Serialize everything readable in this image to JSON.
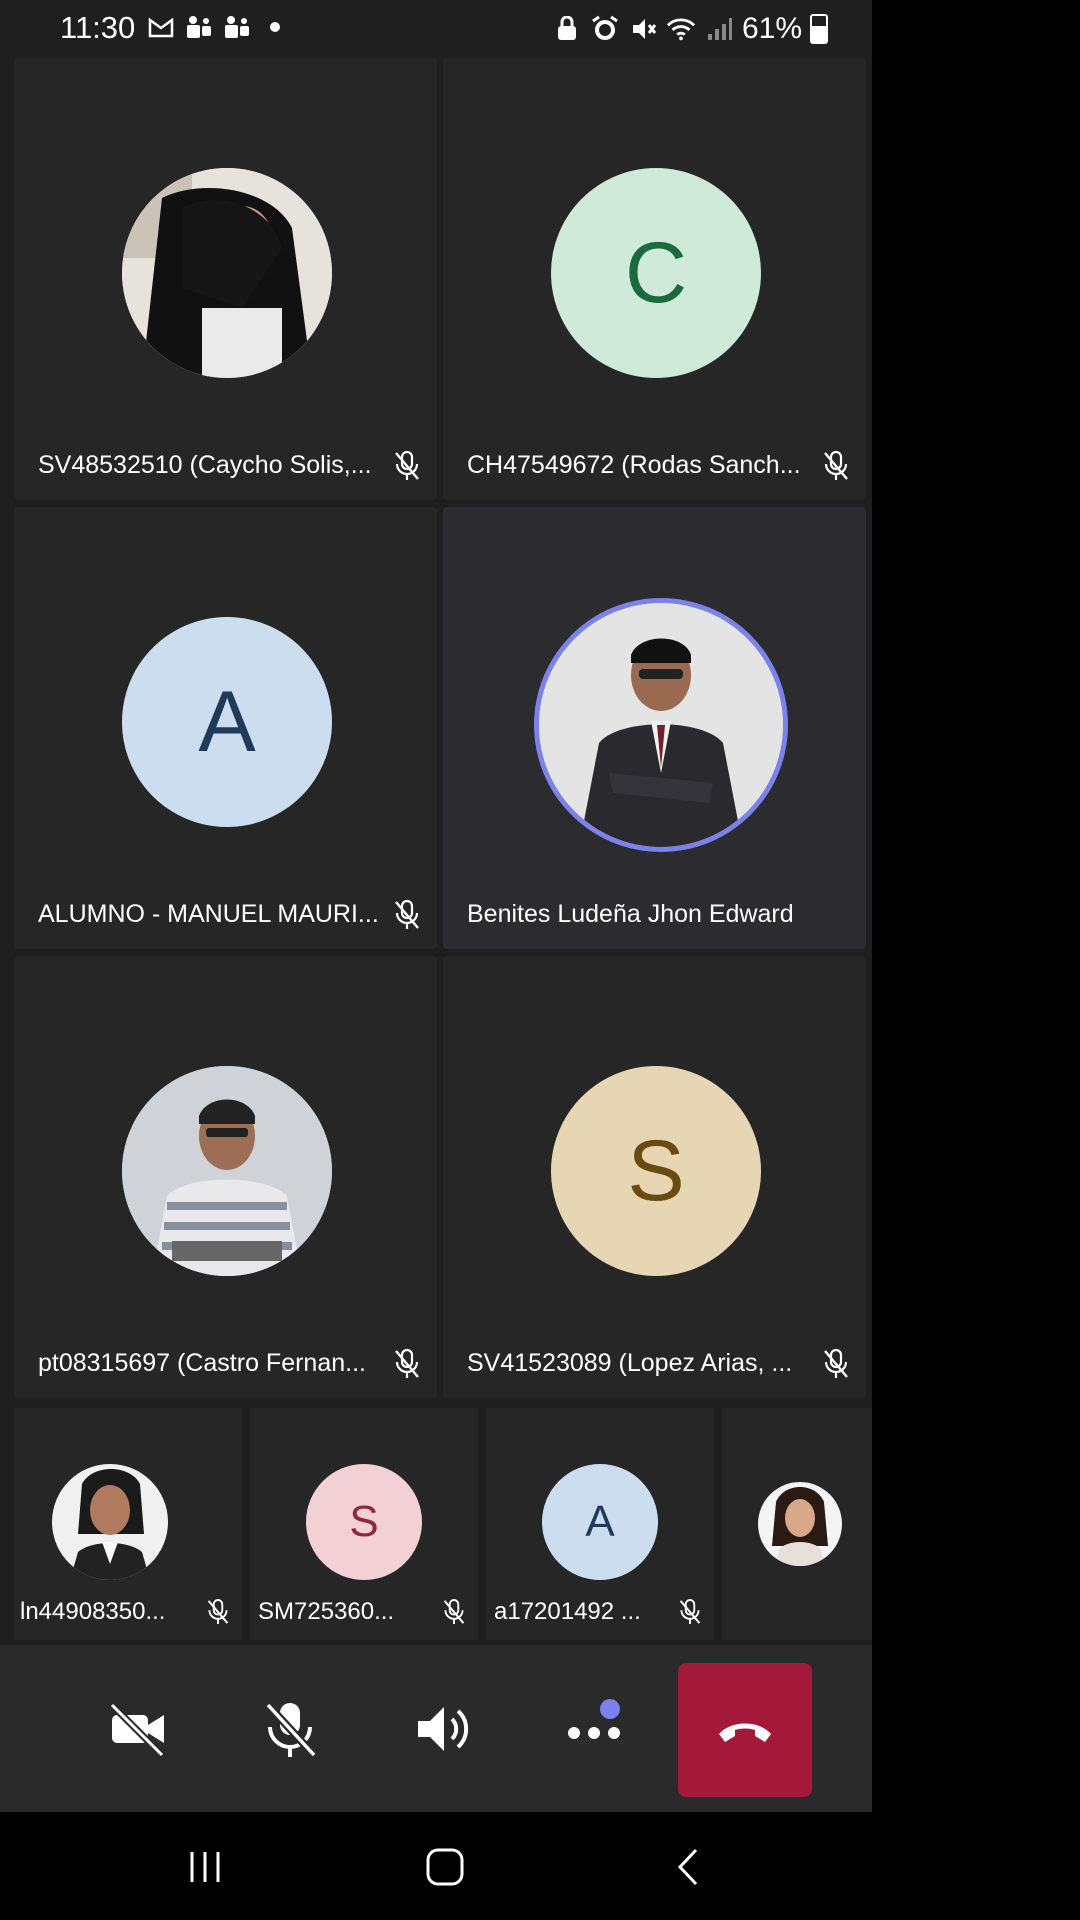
{
  "status": {
    "time": "11:30",
    "battery": "61%"
  },
  "tiles": [
    {
      "name": "SV48532510 (Caycho Solis,...",
      "avatar": "photo-woman-hair",
      "muted": true
    },
    {
      "name": "CH47549672 (Rodas Sanch...",
      "avatar_letter": "C",
      "muted": true
    },
    {
      "name": "ALUMNO - MANUEL MAURI...",
      "avatar_letter": "A",
      "muted": true
    },
    {
      "name": "Benites Ludeña Jhon Edward",
      "avatar": "photo-man-suit",
      "muted": false,
      "speaking": true
    },
    {
      "name": "pt08315697 (Castro Fernan...",
      "avatar": "photo-man-sweater",
      "muted": true
    },
    {
      "name": "SV41523089 (Lopez Arias, ...",
      "avatar_letter": "S",
      "muted": true
    }
  ],
  "small_tiles": [
    {
      "name": "ln44908350...",
      "avatar": "photo-woman",
      "muted": true
    },
    {
      "name": "SM725360...",
      "avatar_letter": "S",
      "muted": true
    },
    {
      "name": "a17201492 ...",
      "avatar_letter": "A",
      "muted": true
    },
    {
      "name": "",
      "avatar": "photo-woman-small",
      "muted": false
    }
  ],
  "controls": {
    "camera": "camera-off-icon",
    "mic": "mic-off-icon",
    "speaker": "speaker-icon",
    "more": "more-icon",
    "hangup": "hangup-icon"
  },
  "colors": {
    "accent": "#7b83eb",
    "hangup": "#a4183a"
  }
}
